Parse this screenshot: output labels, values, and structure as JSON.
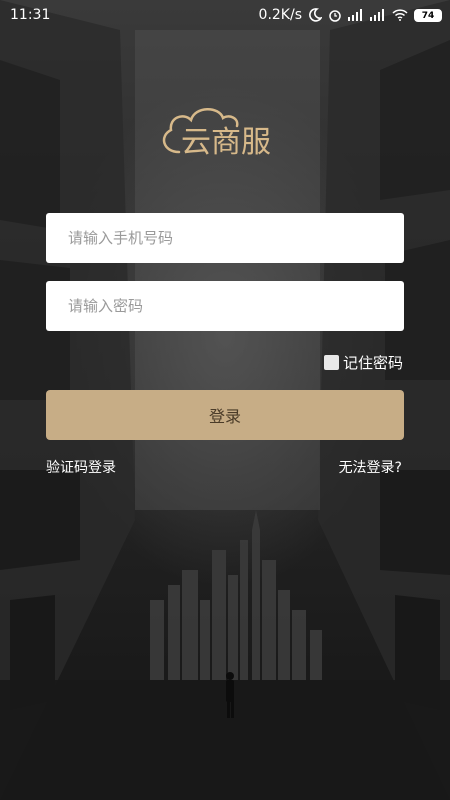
{
  "status_bar": {
    "time": "11:31",
    "network_speed": "0.2K/s",
    "battery_level": "74",
    "icons": [
      "moon-icon",
      "alarm-icon",
      "signal-icon",
      "signal-icon",
      "wifi-icon",
      "battery-icon"
    ]
  },
  "logo": {
    "text": "云商服",
    "icon": "cloud-icon"
  },
  "form": {
    "phone_placeholder": "请输入手机号码",
    "password_placeholder": "请输入密码",
    "remember_label": "记住密码",
    "login_label": "登录"
  },
  "links": {
    "sms_login": "验证码登录",
    "cannot_login": "无法登录?"
  },
  "colors": {
    "accent": "#c7ad86",
    "logo_gold": "#d7b98a",
    "background": "#1b1b1b"
  }
}
